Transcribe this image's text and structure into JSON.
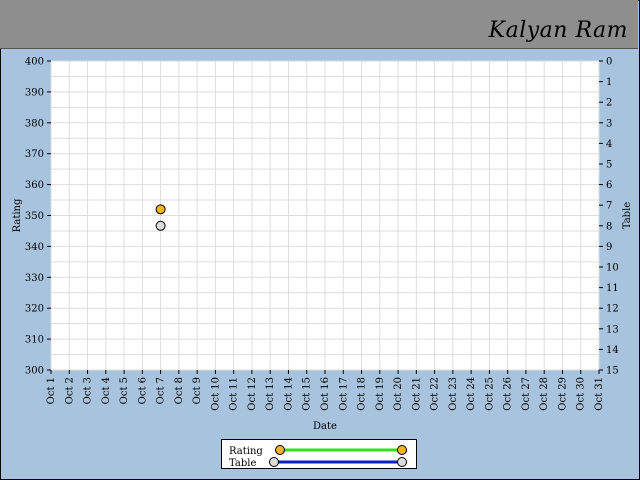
{
  "header": {
    "player_name": "Kalyan Ram"
  },
  "colors": {
    "background": "#a7c3dd",
    "header": "#8e8e8e",
    "rating_marker": "#f5b31f",
    "rating_line": "#33dd22",
    "table_marker": "#dcdcdc",
    "table_line": "#0a1ecc"
  },
  "chart_data": {
    "type": "scatter",
    "xlabel": "Date",
    "ylabel": "Rating",
    "y2label": "Table",
    "categories": [
      "Oct 1",
      "Oct 2",
      "Oct 3",
      "Oct 4",
      "Oct 5",
      "Oct 6",
      "Oct 7",
      "Oct 8",
      "Oct 9",
      "Oct 10",
      "Oct 11",
      "Oct 12",
      "Oct 13",
      "Oct 14",
      "Oct 15",
      "Oct 16",
      "Oct 17",
      "Oct 18",
      "Oct 19",
      "Oct 20",
      "Oct 21",
      "Oct 22",
      "Oct 23",
      "Oct 24",
      "Oct 25",
      "Oct 26",
      "Oct 27",
      "Oct 28",
      "Oct 29",
      "Oct 30",
      "Oct 31"
    ],
    "ylim": [
      300,
      400
    ],
    "yticks": [
      300,
      310,
      320,
      330,
      340,
      350,
      360,
      370,
      380,
      390,
      400
    ],
    "y2lim": [
      0,
      15
    ],
    "y2ticks": [
      0,
      1,
      2,
      3,
      4,
      5,
      6,
      7,
      8,
      9,
      10,
      11,
      12,
      13,
      14,
      15
    ],
    "y2_inverted": true,
    "grid": true,
    "legend_position": "bottom-center",
    "series": [
      {
        "name": "Rating",
        "axis": "left",
        "points": [
          {
            "x": "Oct 7",
            "y": 352
          }
        ]
      },
      {
        "name": "Table",
        "axis": "right",
        "points": [
          {
            "x": "Oct 7",
            "y": 8
          }
        ]
      }
    ]
  }
}
